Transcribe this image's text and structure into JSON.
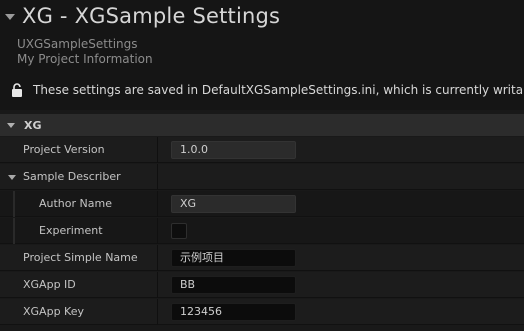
{
  "header": {
    "title": "XG - XGSample Settings",
    "class_name": "UXGSampleSettings",
    "category_description": "My Project Information",
    "save_notice": "These settings are saved in DefaultXGSampleSettings.ini, which is currently writable."
  },
  "section": {
    "label": "XG"
  },
  "properties": {
    "project_version": {
      "label": "Project Version",
      "value": "1.0.0"
    },
    "sample_describer": {
      "label": "Sample Describer"
    },
    "author_name": {
      "label": "Author Name",
      "value": "XG"
    },
    "experiment": {
      "label": "Experiment",
      "checked": false
    },
    "project_simple_name": {
      "label": "Project Simple Name",
      "value": "示例项目"
    },
    "xgapp_id": {
      "label": "XGApp ID",
      "value": "BB"
    },
    "xgapp_key": {
      "label": "XGApp Key",
      "value": "123456"
    }
  },
  "icons": {
    "collapse": "triangle-down-icon",
    "lock": "unlock-icon"
  }
}
